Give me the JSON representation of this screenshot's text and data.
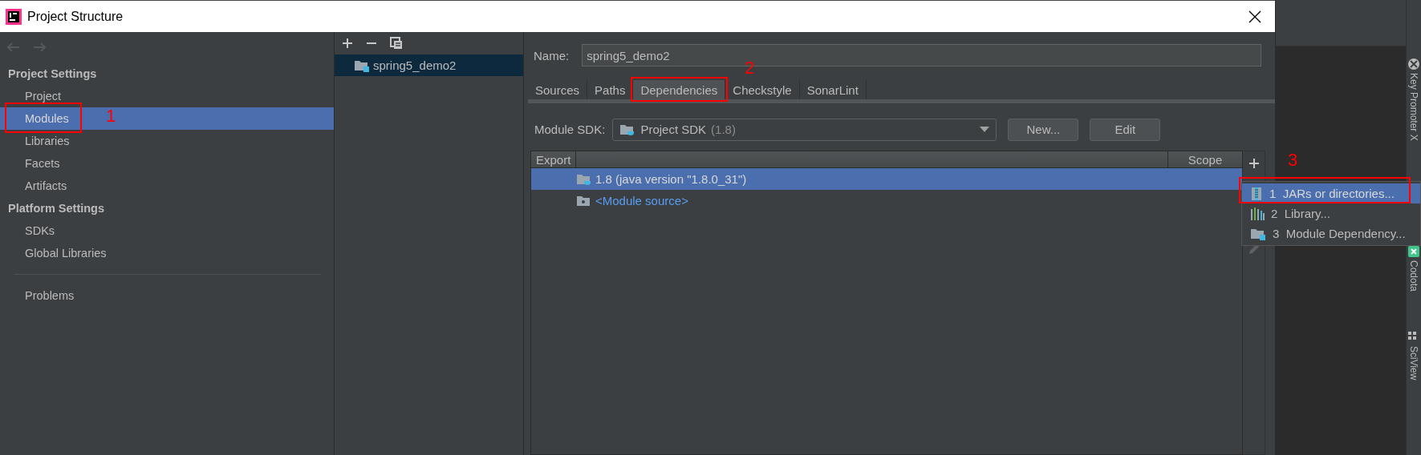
{
  "window": {
    "title": "Project Structure"
  },
  "sidebar": {
    "sections": [
      {
        "title": "Project Settings",
        "items": [
          {
            "label": "Project",
            "selected": false
          },
          {
            "label": "Modules",
            "selected": true,
            "annotation": "1"
          },
          {
            "label": "Libraries",
            "selected": false
          },
          {
            "label": "Facets",
            "selected": false
          },
          {
            "label": "Artifacts",
            "selected": false
          }
        ]
      },
      {
        "title": "Platform Settings",
        "items": [
          {
            "label": "SDKs",
            "selected": false
          },
          {
            "label": "Global Libraries",
            "selected": false
          }
        ]
      }
    ],
    "footer_items": [
      {
        "label": "Problems",
        "selected": false
      }
    ]
  },
  "modules": {
    "items": [
      {
        "name": "spring5_demo2",
        "selected": true
      }
    ]
  },
  "detail": {
    "name_label": "Name:",
    "name_value": "spring5_demo2",
    "tabs": [
      {
        "label": "Sources",
        "selected": false
      },
      {
        "label": "Paths",
        "selected": false
      },
      {
        "label": "Dependencies",
        "selected": true,
        "annotation": "2"
      },
      {
        "label": "Checkstyle",
        "selected": false
      },
      {
        "label": "SonarLint",
        "selected": false
      }
    ],
    "sdk_label": "Module SDK:",
    "sdk_value": "Project SDK",
    "sdk_version": "(1.8)",
    "buttons": [
      "New...",
      "Edit"
    ],
    "table": {
      "columns": [
        "Export",
        "Scope"
      ],
      "rows": [
        {
          "text": "1.8 (java version \"1.8.0_31\")",
          "kind": "sdk",
          "selected": true
        },
        {
          "text": "<Module source>",
          "kind": "source",
          "selected": false
        }
      ]
    }
  },
  "add_menu": {
    "annotation": "3",
    "items": [
      {
        "number": "1",
        "label": "JARs or directories...",
        "kind": "jar",
        "selected": true
      },
      {
        "number": "2",
        "label": "Library...",
        "kind": "library",
        "selected": false
      },
      {
        "number": "3",
        "label": "Module Dependency...",
        "kind": "module",
        "selected": false
      }
    ]
  },
  "tool_strip": [
    "Key Promoter X",
    "Codota",
    "SciView"
  ]
}
